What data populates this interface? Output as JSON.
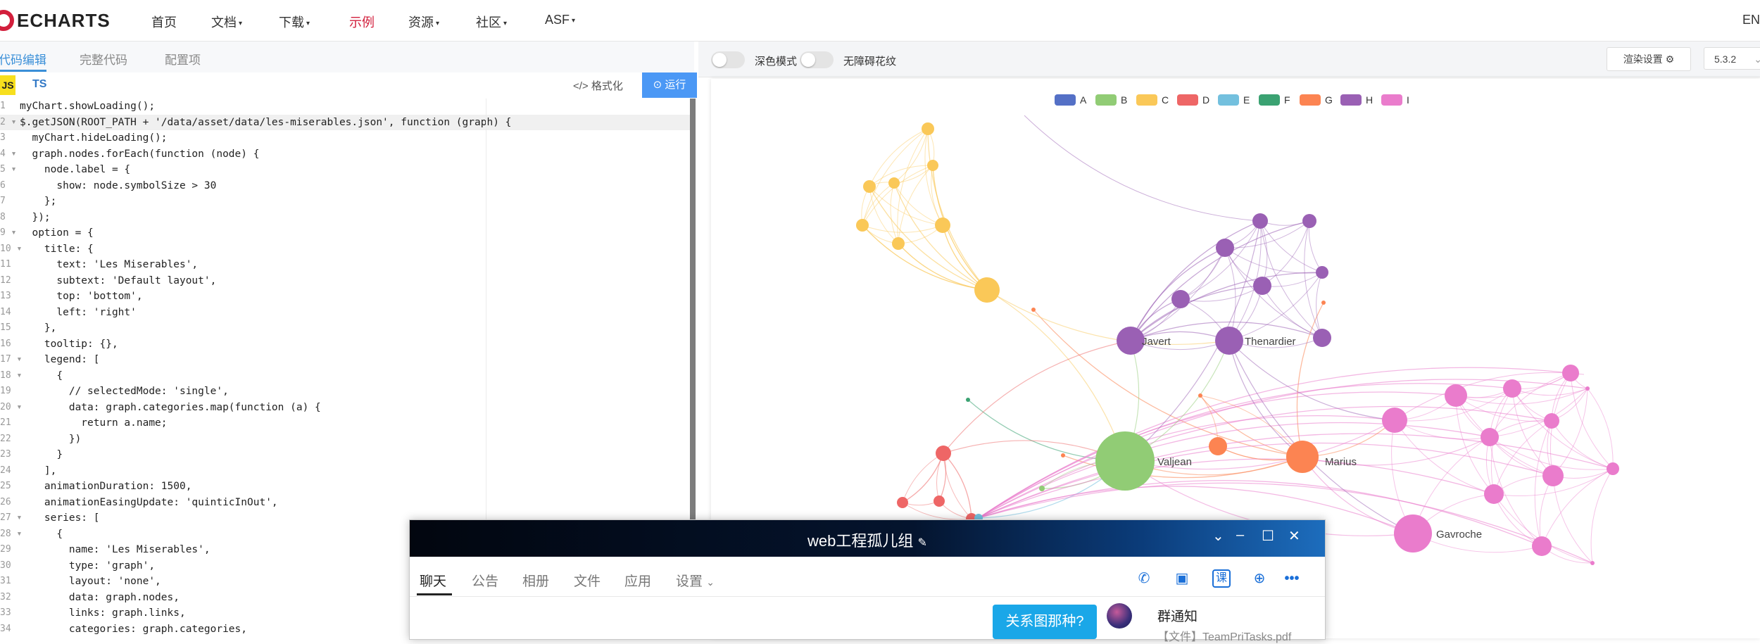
{
  "nav": {
    "logo_text": "ECHARTS",
    "items": [
      {
        "label": "首页",
        "dropdown": false,
        "active": false
      },
      {
        "label": "文档",
        "dropdown": true,
        "active": false
      },
      {
        "label": "下载",
        "dropdown": true,
        "active": false
      },
      {
        "label": "示例",
        "dropdown": false,
        "active": true
      },
      {
        "label": "资源",
        "dropdown": true,
        "active": false
      },
      {
        "label": "社区",
        "dropdown": true,
        "active": false
      },
      {
        "label": "ASF",
        "dropdown": true,
        "active": false
      }
    ],
    "lang": "EN",
    "accent_color": "#d21f3c"
  },
  "editor": {
    "tabs": [
      "代码编辑",
      "完整代码",
      "配置项"
    ],
    "js_label": "JS",
    "ts_label": "TS",
    "format_label": "格式化",
    "run_label": "运行",
    "lines": [
      {
        "n": "1",
        "text": "myChart.showLoading();"
      },
      {
        "n": "2 ▾",
        "text": "$.getJSON(ROOT_PATH + '/data/asset/data/les-miserables.json', function (graph) {"
      },
      {
        "n": "3",
        "text": "  myChart.hideLoading();"
      },
      {
        "n": "4 ▾",
        "text": "  graph.nodes.forEach(function (node) {"
      },
      {
        "n": "5 ▾",
        "text": "    node.label = {"
      },
      {
        "n": "6",
        "text": "      show: node.symbolSize > 30"
      },
      {
        "n": "7",
        "text": "    };"
      },
      {
        "n": "8",
        "text": "  });"
      },
      {
        "n": "9 ▾",
        "text": "  option = {"
      },
      {
        "n": "10 ▾",
        "text": "    title: {"
      },
      {
        "n": "11",
        "text": "      text: 'Les Miserables',"
      },
      {
        "n": "12",
        "text": "      subtext: 'Default layout',"
      },
      {
        "n": "13",
        "text": "      top: 'bottom',"
      },
      {
        "n": "14",
        "text": "      left: 'right'"
      },
      {
        "n": "15",
        "text": "    },"
      },
      {
        "n": "16",
        "text": "    tooltip: {},"
      },
      {
        "n": "17 ▾",
        "text": "    legend: ["
      },
      {
        "n": "18 ▾",
        "text": "      {"
      },
      {
        "n": "19",
        "text": "        // selectedMode: 'single',"
      },
      {
        "n": "20 ▾",
        "text": "        data: graph.categories.map(function (a) {"
      },
      {
        "n": "21",
        "text": "          return a.name;"
      },
      {
        "n": "22",
        "text": "        })"
      },
      {
        "n": "23",
        "text": "      }"
      },
      {
        "n": "24",
        "text": "    ],"
      },
      {
        "n": "25",
        "text": "    animationDuration: 1500,"
      },
      {
        "n": "26",
        "text": "    animationEasingUpdate: 'quinticInOut',"
      },
      {
        "n": "27 ▾",
        "text": "    series: ["
      },
      {
        "n": "28 ▾",
        "text": "      {"
      },
      {
        "n": "29",
        "text": "        name: 'Les Miserables',"
      },
      {
        "n": "30",
        "text": "        type: 'graph',"
      },
      {
        "n": "31",
        "text": "        layout: 'none',"
      },
      {
        "n": "32",
        "text": "        data: graph.nodes,"
      },
      {
        "n": "33",
        "text": "        links: graph.links,"
      },
      {
        "n": "34",
        "text": "        categories: graph.categories,"
      }
    ]
  },
  "toolbar": {
    "dark_mode_label": "深色模式",
    "accessibility_label": "无障碍花纹",
    "render_settings_label": "渲染设置",
    "version": "5.3.2"
  },
  "chart_data": {
    "type": "graph",
    "legend": [
      {
        "name": "A",
        "color": "#5470c6"
      },
      {
        "name": "B",
        "color": "#91cc75"
      },
      {
        "name": "C",
        "color": "#fac858"
      },
      {
        "name": "D",
        "color": "#ee6666"
      },
      {
        "name": "E",
        "color": "#73c0de"
      },
      {
        "name": "F",
        "color": "#3ba272"
      },
      {
        "name": "G",
        "color": "#fc8452"
      },
      {
        "name": "H",
        "color": "#9a60b4"
      },
      {
        "name": "I",
        "color": "#ea7ccc"
      }
    ],
    "legend_placement": "top-center",
    "labeled_nodes": [
      "Javert",
      "Thenardier",
      "Valjean",
      "Marius",
      "Gavroche"
    ]
  },
  "chat": {
    "title": "web工程孤儿组",
    "tabs": [
      "聊天",
      "公告",
      "相册",
      "文件",
      "应用",
      "设置"
    ],
    "bubble_text": "关系图那种?",
    "notice_title": "群通知",
    "notice_file": "【文件】TeamPriTasks.pdf"
  }
}
